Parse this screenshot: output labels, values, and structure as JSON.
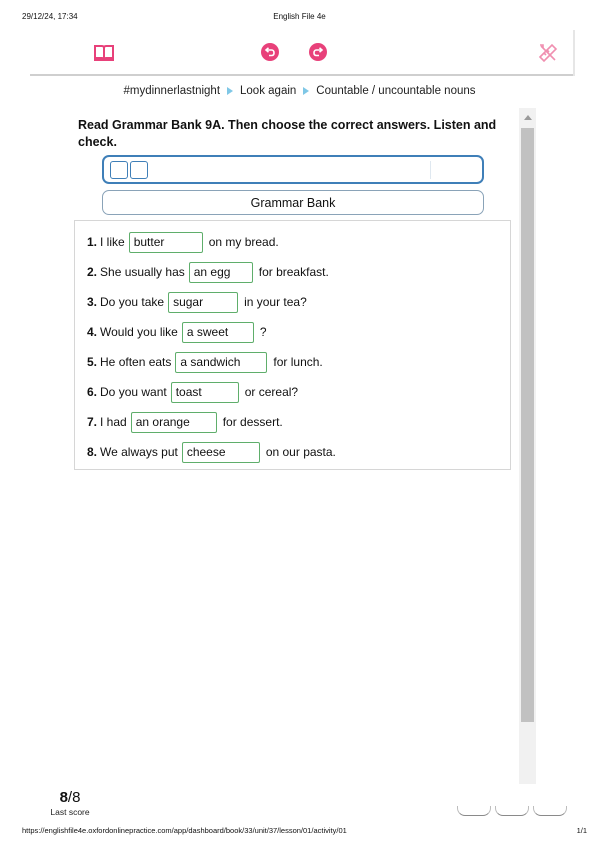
{
  "print_header": {
    "date": "29/12/24, 17:34",
    "title": "English File 4e"
  },
  "toolbar": {
    "icons": [
      "book-icon",
      "undo-icon",
      "redo-icon",
      "tools-icon"
    ],
    "accent_color": "#e8417a"
  },
  "breadcrumb": [
    "#mydinnerlastnight",
    "Look again",
    "Countable / uncountable nouns"
  ],
  "instruction": "Read Grammar Bank 9A. Then choose the correct answers. Listen and check.",
  "grammar_bank_button": "Grammar Bank",
  "items": [
    {
      "num": "1.",
      "before": "I like",
      "answer": "butter",
      "after": "on my bread."
    },
    {
      "num": "2.",
      "before": "She usually has",
      "answer": "an egg",
      "after": "for breakfast."
    },
    {
      "num": "3.",
      "before": "Do you take",
      "answer": "sugar",
      "after": "in your tea?"
    },
    {
      "num": "4.",
      "before": "Would you like",
      "answer": "a sweet",
      "after": "?"
    },
    {
      "num": "5.",
      "before": "He often eats",
      "answer": "a sandwich",
      "after": "for lunch."
    },
    {
      "num": "6.",
      "before": "Do you want",
      "answer": "toast",
      "after": "or cereal?"
    },
    {
      "num": "7.",
      "before": "I had",
      "answer": "an orange",
      "after": "for dessert."
    },
    {
      "num": "8.",
      "before": "We always put",
      "answer": "cheese",
      "after": "on our pasta."
    }
  ],
  "score": {
    "value": "8",
    "total": "/8",
    "label": "Last score"
  },
  "print_footer": {
    "url": "https://englishfile4e.oxfordonlinepractice.com/app/dashboard/book/33/unit/37/lesson/01/activity/01",
    "page": "1/1"
  }
}
